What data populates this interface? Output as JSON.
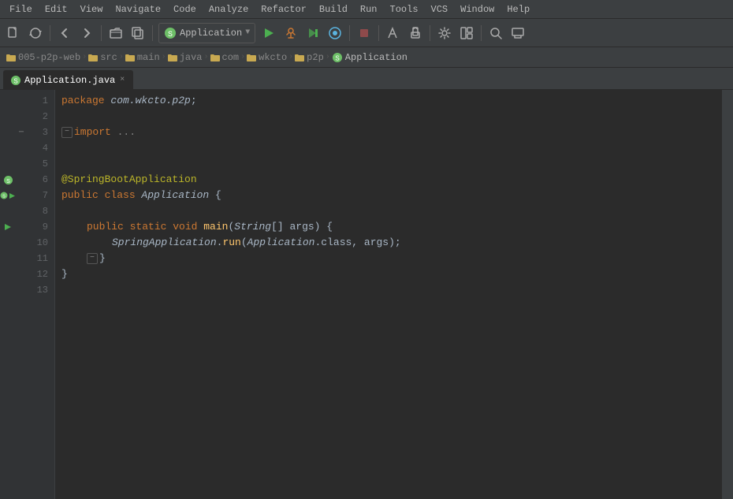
{
  "menubar": {
    "items": [
      "File",
      "Edit",
      "View",
      "Navigate",
      "Code",
      "Analyze",
      "Refactor",
      "Build",
      "Run",
      "Tools",
      "VCS",
      "Window",
      "Help"
    ]
  },
  "toolbar": {
    "run_config": "Application",
    "run_config_dropdown": "▼"
  },
  "breadcrumb": {
    "items": [
      {
        "label": "005-p2p-web",
        "type": "project"
      },
      {
        "label": "src",
        "type": "folder"
      },
      {
        "label": "main",
        "type": "folder"
      },
      {
        "label": "java",
        "type": "folder"
      },
      {
        "label": "com",
        "type": "folder"
      },
      {
        "label": "wkcto",
        "type": "folder"
      },
      {
        "label": "p2p",
        "type": "folder"
      },
      {
        "label": "Application",
        "type": "class"
      }
    ]
  },
  "tab": {
    "filename": "Application.java",
    "close": "×"
  },
  "code": {
    "lines": [
      {
        "num": 1,
        "content": "package com.wkcto.p2p;"
      },
      {
        "num": 2,
        "content": ""
      },
      {
        "num": 3,
        "content": "import ..."
      },
      {
        "num": 4,
        "content": ""
      },
      {
        "num": 5,
        "content": ""
      },
      {
        "num": 6,
        "content": "@SpringBootApplication"
      },
      {
        "num": 7,
        "content": "public class Application {"
      },
      {
        "num": 8,
        "content": ""
      },
      {
        "num": 9,
        "content": "    public static void main(String[] args) {"
      },
      {
        "num": 10,
        "content": "        SpringApplication.run(Application.class, args);"
      },
      {
        "num": 11,
        "content": "    }"
      },
      {
        "num": 12,
        "content": "}"
      },
      {
        "num": 13,
        "content": ""
      }
    ]
  }
}
